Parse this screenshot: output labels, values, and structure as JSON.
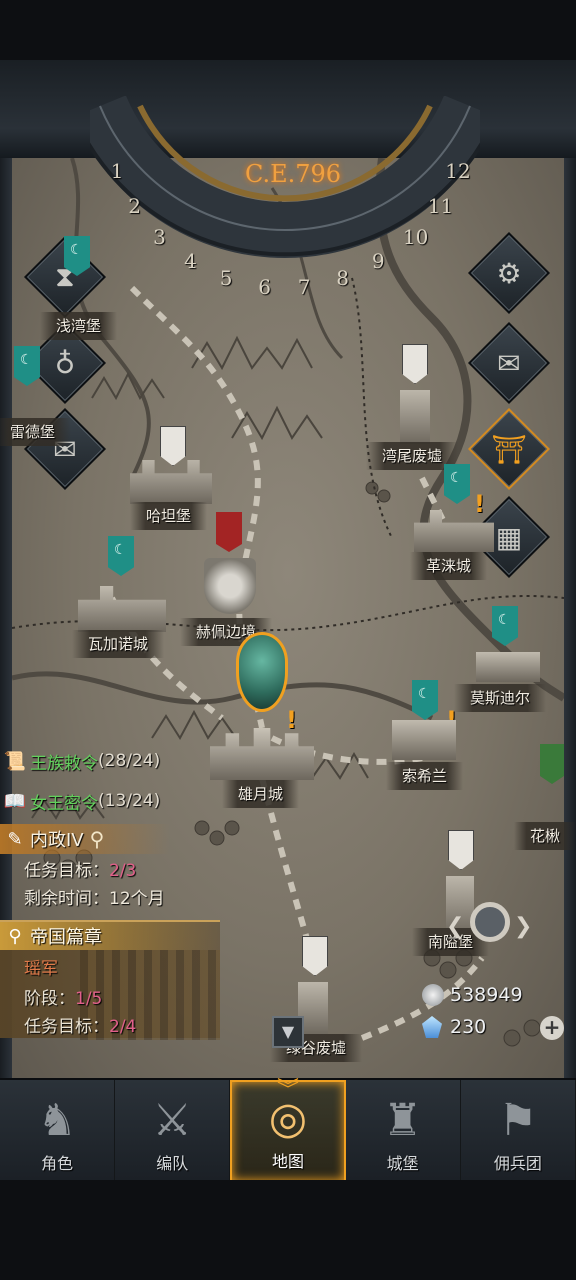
{
  "calendar": {
    "era": "C.E.796",
    "months": [
      "1",
      "2",
      "3",
      "4",
      "5",
      "6",
      "7",
      "8",
      "9",
      "10",
      "11",
      "12"
    ]
  },
  "cities": [
    {
      "name": "浅湾堡"
    },
    {
      "name": "雷德堡"
    },
    {
      "name": "哈坦堡"
    },
    {
      "name": "湾尾废墟"
    },
    {
      "name": "革涞城"
    },
    {
      "name": "瓦加诺城"
    },
    {
      "name": "赫佩边境"
    },
    {
      "name": "莫斯迪尔"
    },
    {
      "name": "雄月城"
    },
    {
      "name": "索希兰"
    },
    {
      "name": "花楸"
    },
    {
      "name": "南隘堡"
    },
    {
      "name": "绿谷废墟"
    }
  ],
  "side_icons": {
    "left": [
      "hourglass-icon",
      "treasure-bag-icon",
      "scroll-icon"
    ],
    "right": [
      "gear-icon",
      "mail-icon",
      "gate-icon",
      "cargo-icon"
    ]
  },
  "quests": {
    "royal_edict": {
      "name": "王族敕令",
      "count": "(28/24)"
    },
    "queen_order": {
      "name": "女王密令",
      "count": "(13/24)"
    },
    "policy": {
      "name": "内政IV",
      "goal_label": "任务目标：",
      "goal_value": "2/3",
      "time_label": "剩余时间：",
      "time_value": "12个月"
    },
    "empire": {
      "title": "帝国篇章",
      "subtitle": "瑶军",
      "stage_label": "阶段：",
      "stage_value": "1/5",
      "goal_label": "任务目标：",
      "goal_value": "2/4"
    }
  },
  "resources": {
    "silver": "538949",
    "gems": "230"
  },
  "nav": {
    "items": [
      {
        "label": "角色",
        "icon": "knight-icon"
      },
      {
        "label": "编队",
        "icon": "formation-icon"
      },
      {
        "label": "地图",
        "icon": "map-icon"
      },
      {
        "label": "城堡",
        "icon": "castle-icon"
      },
      {
        "label": "佣兵团",
        "icon": "mercenary-icon"
      }
    ],
    "active": "地图"
  },
  "colors": {
    "accent": "#f0a020",
    "quest_green": "#62d05c",
    "progress_pink": "#e0608a",
    "banner_teal": "#1f8f86"
  }
}
